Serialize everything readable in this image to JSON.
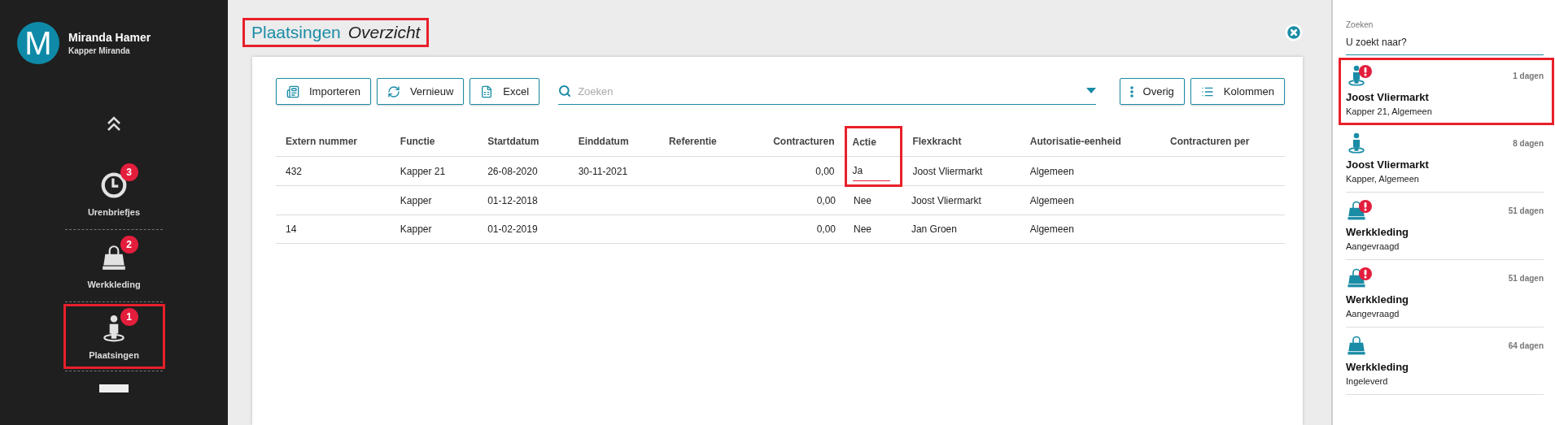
{
  "user": {
    "initial": "M",
    "name": "Miranda Hamer",
    "subtitle": "Kapper Miranda"
  },
  "nav": [
    {
      "kind": "clock",
      "label": "Urenbriefjes",
      "badge": "3",
      "highlighted": false
    },
    {
      "kind": "bag",
      "label": "Werkkleding",
      "badge": "2",
      "highlighted": false
    },
    {
      "kind": "person",
      "label": "Plaatsingen",
      "badge": "1",
      "highlighted": true
    }
  ],
  "page": {
    "title": "Plaatsingen",
    "subtitle": "Overzicht",
    "highlighted": true
  },
  "toolbar": {
    "left": [
      {
        "kind": "import",
        "label": "Importeren"
      },
      {
        "kind": "refresh",
        "label": "Vernieuw"
      },
      {
        "kind": "excel",
        "label": "Excel"
      }
    ],
    "search": {
      "placeholder": "Zoeken"
    },
    "right": [
      {
        "kind": "more",
        "label": "Overig"
      },
      {
        "kind": "columns",
        "label": "Kolommen"
      }
    ]
  },
  "table": {
    "columns": [
      {
        "label": "Extern nummer",
        "highlighted": false
      },
      {
        "label": "Functie",
        "highlighted": false
      },
      {
        "label": "Startdatum",
        "highlighted": false
      },
      {
        "label": "Einddatum",
        "highlighted": false
      },
      {
        "label": "Referentie",
        "highlighted": false
      },
      {
        "label": "Contracturen",
        "highlighted": false
      },
      {
        "label": "Actie",
        "highlighted": true
      },
      {
        "label": "Flexkracht",
        "highlighted": false
      },
      {
        "label": "Autorisatie-eenheid",
        "highlighted": false
      },
      {
        "label": "Contracturen per",
        "highlighted": false
      }
    ],
    "rows": [
      {
        "cells": [
          "432",
          "Kapper 21",
          "26-08-2020",
          "30-11-2021",
          "",
          "0,00",
          "Ja",
          "Joost Vliermarkt",
          "Algemeen",
          ""
        ],
        "editing": true
      },
      {
        "cells": [
          "",
          "Kapper",
          "01-12-2018",
          "",
          "",
          "0,00",
          "Nee",
          "Joost Vliermarkt",
          "Algemeen",
          ""
        ],
        "editing": false
      },
      {
        "cells": [
          "14",
          "Kapper",
          "01-02-2019",
          "",
          "",
          "0,00",
          "Nee",
          "Jan Groen",
          "Algemeen",
          ""
        ],
        "editing": false
      }
    ]
  },
  "side_search": {
    "label": "Zoeken",
    "value": "U zoekt naar?"
  },
  "feed": [
    {
      "kind": "person",
      "alert": true,
      "age": "1 dagen",
      "title": "Joost Vliermarkt",
      "detail": "Kapper 21, Algemeen",
      "highlighted": true
    },
    {
      "kind": "person",
      "alert": false,
      "age": "8 dagen",
      "title": "Joost Vliermarkt",
      "detail": "Kapper, Algemeen",
      "highlighted": false
    },
    {
      "kind": "bag",
      "alert": true,
      "age": "51 dagen",
      "title": "Werkkleding",
      "detail": "Aangevraagd",
      "highlighted": false
    },
    {
      "kind": "bag",
      "alert": true,
      "age": "51 dagen",
      "title": "Werkkleding",
      "detail": "Aangevraagd",
      "highlighted": false
    },
    {
      "kind": "bag",
      "alert": false,
      "age": "64 dagen",
      "title": "Werkkleding",
      "detail": "Ingeleverd",
      "highlighted": false
    }
  ]
}
